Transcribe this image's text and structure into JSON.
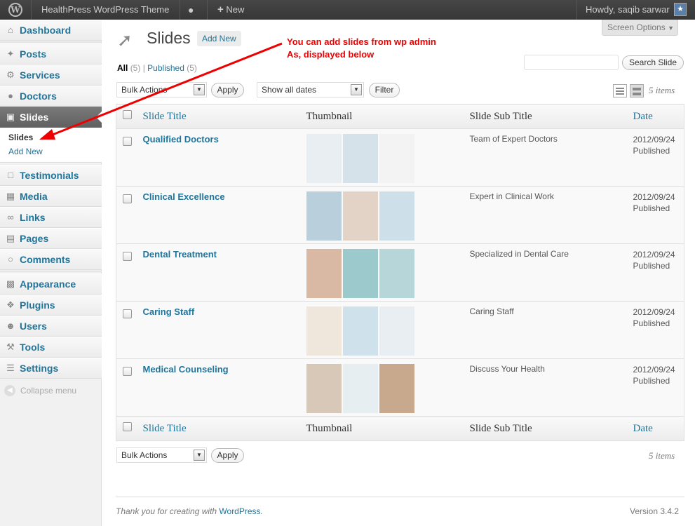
{
  "adminbar": {
    "site_name": "HealthPress WordPress Theme",
    "new_label": "New",
    "howdy": "Howdy, saqib sarwar"
  },
  "sidebar": {
    "items": [
      {
        "label": "Dashboard",
        "icon": "home-icon"
      },
      {
        "label": "Posts",
        "icon": "pin-icon"
      },
      {
        "label": "Services",
        "icon": "gear-icon"
      },
      {
        "label": "Doctors",
        "icon": "people-icon"
      },
      {
        "label": "Slides",
        "icon": "image-icon"
      },
      {
        "label": "Testimonials",
        "icon": "speech-icon"
      },
      {
        "label": "Media",
        "icon": "media-icon"
      },
      {
        "label": "Links",
        "icon": "link-icon"
      },
      {
        "label": "Pages",
        "icon": "pages-icon"
      },
      {
        "label": "Comments",
        "icon": "comment-icon"
      },
      {
        "label": "Appearance",
        "icon": "appearance-icon"
      },
      {
        "label": "Plugins",
        "icon": "plugin-icon"
      },
      {
        "label": "Users",
        "icon": "users-icon"
      },
      {
        "label": "Tools",
        "icon": "tools-icon"
      },
      {
        "label": "Settings",
        "icon": "settings-icon"
      }
    ],
    "submenu": {
      "current": "Slides",
      "add_new": "Add New"
    },
    "collapse": "Collapse menu"
  },
  "header": {
    "screen_options": "Screen Options",
    "title": "Slides",
    "add_new": "Add New",
    "annotation_line1": "You can add slides from wp admin",
    "annotation_line2": "As, displayed below"
  },
  "filters": {
    "all": "All",
    "all_count": "(5)",
    "sep": "|",
    "published": "Published",
    "published_count": "(5)",
    "search_button": "Search Slide",
    "bulk_actions": "Bulk Actions",
    "apply": "Apply",
    "dates": "Show all dates",
    "filter": "Filter",
    "items_count": "5 items"
  },
  "table": {
    "headers": {
      "title": "Slide Title",
      "thumbnail": "Thumbnail",
      "subtitle": "Slide Sub Title",
      "date": "Date"
    },
    "rows": [
      {
        "title": "Qualified Doctors",
        "subtitle": "Team of Expert Doctors",
        "date": "2012/09/24",
        "status": "Published",
        "colors": [
          "#e8eef2",
          "#d6e2ea",
          "#f3f3f3"
        ]
      },
      {
        "title": "Clinical Excellence",
        "subtitle": "Expert in Clinical Work",
        "date": "2012/09/24",
        "status": "Published",
        "colors": [
          "#b9cfdc",
          "#e3d3c7",
          "#cde0ea"
        ]
      },
      {
        "title": "Dental Treatment",
        "subtitle": "Specialized in Dental Care",
        "date": "2012/09/24",
        "status": "Published",
        "colors": [
          "#d9b9a4",
          "#9cc9cc",
          "#b7d6d9"
        ]
      },
      {
        "title": "Caring Staff",
        "subtitle": "Caring Staff",
        "date": "2012/09/24",
        "status": "Published",
        "colors": [
          "#efe6dc",
          "#cfe1ea",
          "#e9eef2"
        ]
      },
      {
        "title": "Medical Counseling",
        "subtitle": "Discuss Your Health",
        "date": "2012/09/24",
        "status": "Published",
        "colors": [
          "#d8c8b8",
          "#e6eef1",
          "#c9a98e"
        ]
      }
    ]
  },
  "bottom": {
    "bulk_actions": "Bulk Actions",
    "apply": "Apply",
    "items_count": "5 items"
  },
  "footer": {
    "thanks": "Thank you for creating with ",
    "wordpress": "WordPress",
    "period": ".",
    "version": "Version 3.4.2"
  },
  "colors": {
    "accent": "#21759b",
    "annotation": "#ee0000",
    "active_menu": "#6d6d6d"
  }
}
